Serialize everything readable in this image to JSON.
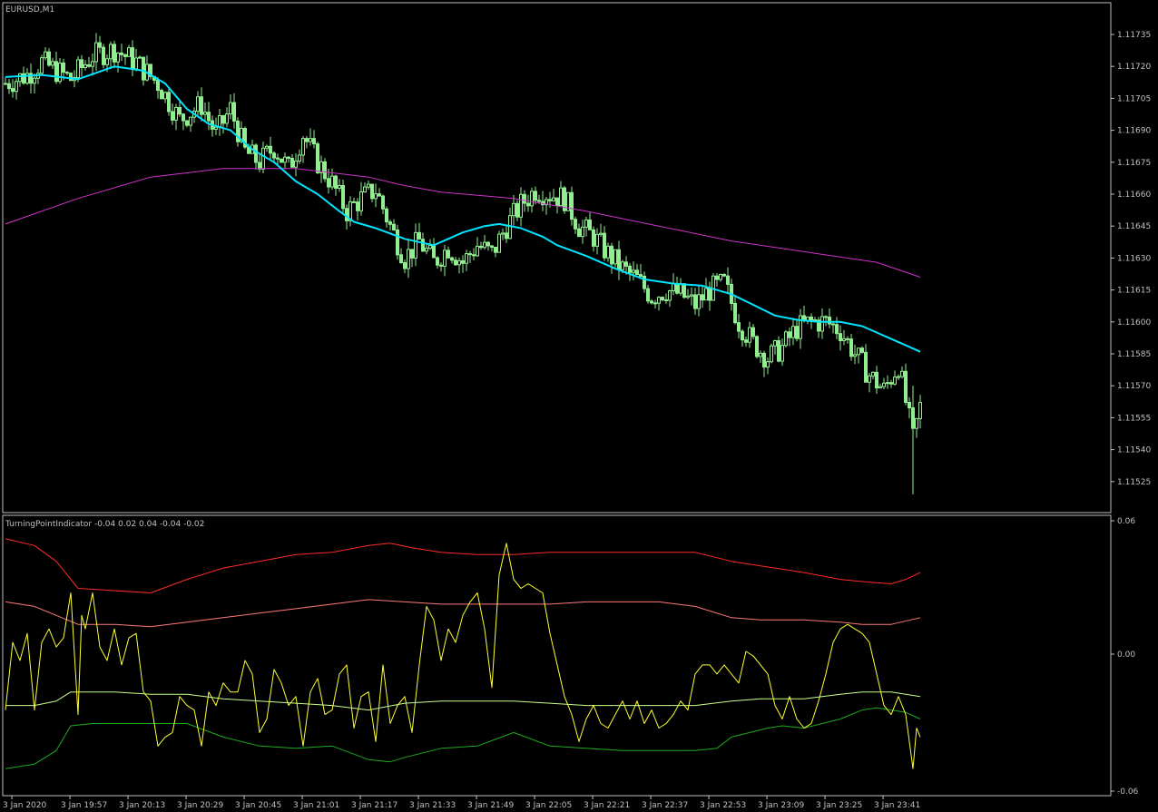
{
  "main_panel": {
    "title": "EURUSD,M1",
    "price_ticks": [
      "1.11735",
      "1.11720",
      "1.11705",
      "1.11690",
      "1.11675",
      "1.11660",
      "1.11645",
      "1.11630",
      "1.11615",
      "1.11600",
      "1.11585",
      "1.11570",
      "1.11555",
      "1.11540",
      "1.11525"
    ]
  },
  "indicator_panel": {
    "title": "TurningPointIndicator -0.04 0.02 0.04 -0.04 -0.02",
    "ticks": [
      "0.06",
      "0.00",
      "-0.06"
    ]
  },
  "time_ticks": [
    "3 Jan 2020",
    "3 Jan 19:57",
    "3 Jan 20:13",
    "3 Jan 20:29",
    "3 Jan 20:45",
    "3 Jan 21:01",
    "3 Jan 21:17",
    "3 Jan 21:33",
    "3 Jan 21:49",
    "3 Jan 22:05",
    "3 Jan 22:21",
    "3 Jan 22:37",
    "3 Jan 22:53",
    "3 Jan 23:09",
    "3 Jan 23:25",
    "3 Jan 23:41"
  ],
  "colors": {
    "background": "#000000",
    "frame": "#c0c0c0",
    "candle": "#90ee90",
    "fast_ma": "#00e5ff",
    "slow_ma": "#cc33cc",
    "upper_outer": "#ff2a2a",
    "upper_inner": "#ff7a7a",
    "oscillator": "#ffff33",
    "lower_inner": "#c8ff8a",
    "lower_outer": "#1faa1f",
    "text": "#c0c0c0"
  },
  "chart_data": {
    "type": "line",
    "main": {
      "ylim": [
        1.11515,
        1.11745
      ],
      "close_series": {
        "x_bar": [
          0,
          6,
          10,
          14,
          18,
          24,
          30,
          36,
          42,
          48,
          54,
          58,
          62,
          66,
          70,
          74,
          78,
          82,
          86,
          90,
          94,
          98,
          102,
          106,
          110,
          114,
          118,
          122,
          126,
          130,
          134,
          138,
          142,
          146,
          150,
          154,
          158,
          162,
          166,
          170,
          174,
          178,
          182,
          186,
          190,
          194,
          198,
          202,
          206,
          210,
          214,
          218,
          222,
          226,
          230,
          234,
          238,
          242,
          246,
          250,
          252
        ],
        "y": [
          1.11712,
          1.11716,
          1.11722,
          1.11718,
          1.11714,
          1.11725,
          1.11728,
          1.11722,
          1.11712,
          1.11695,
          1.11702,
          1.11688,
          1.117,
          1.1168,
          1.11675,
          1.11682,
          1.11672,
          1.11688,
          1.11675,
          1.11665,
          1.11652,
          1.11658,
          1.11662,
          1.11645,
          1.1163,
          1.11638,
          1.11628,
          1.11635,
          1.11628,
          1.11636,
          1.11632,
          1.11645,
          1.11655,
          1.11662,
          1.1166,
          1.11658,
          1.11645,
          1.1164,
          1.11632,
          1.11625,
          1.1162,
          1.11612,
          1.11615,
          1.11613,
          1.11608,
          1.11615,
          1.11618,
          1.116,
          1.1159,
          1.11583,
          1.11588,
          1.11597,
          1.116,
          1.116,
          1.11596,
          1.11585,
          1.11575,
          1.11568,
          1.1158,
          1.11545,
          1.1156
        ]
      },
      "fast_ma": {
        "x_bar": [
          0,
          10,
          20,
          30,
          38,
          44,
          50,
          56,
          62,
          68,
          74,
          80,
          86,
          92,
          96,
          102,
          110,
          118,
          126,
          132,
          136,
          142,
          148,
          152,
          160,
          168,
          176,
          184,
          192,
          200,
          206,
          212,
          218,
          224,
          230,
          236,
          240,
          244,
          248,
          252
        ],
        "y": [
          1.11715,
          1.11716,
          1.11714,
          1.1172,
          1.11718,
          1.11712,
          1.117,
          1.11693,
          1.1169,
          1.11681,
          1.11675,
          1.11666,
          1.1166,
          1.11652,
          1.11647,
          1.11644,
          1.11639,
          1.11636,
          1.11642,
          1.11645,
          1.11646,
          1.11644,
          1.1164,
          1.11636,
          1.11631,
          1.11625,
          1.1162,
          1.11618,
          1.11617,
          1.11613,
          1.11608,
          1.11603,
          1.11601,
          1.116,
          1.116,
          1.11598,
          1.11595,
          1.11592,
          1.11589,
          1.11586
        ]
      },
      "slow_ma": {
        "x_bar": [
          0,
          20,
          40,
          60,
          80,
          100,
          110,
          120,
          140,
          160,
          180,
          200,
          220,
          240,
          252
        ],
        "y": [
          1.11646,
          1.11658,
          1.11668,
          1.11672,
          1.11672,
          1.11668,
          1.11664,
          1.11661,
          1.11658,
          1.11652,
          1.11645,
          1.11638,
          1.11633,
          1.11628,
          1.11621
        ]
      }
    },
    "indicator": {
      "ylim": [
        -0.06,
        0.06
      ],
      "upper_outer": {
        "x_bar": [
          0,
          8,
          14,
          20,
          30,
          40,
          50,
          60,
          70,
          80,
          90,
          100,
          106,
          112,
          120,
          130,
          140,
          150,
          160,
          170,
          180,
          190,
          200,
          208,
          212,
          220,
          230,
          236,
          244,
          248,
          252
        ],
        "y": [
          0.052,
          0.049,
          0.042,
          0.03,
          0.029,
          0.028,
          0.034,
          0.039,
          0.042,
          0.045,
          0.046,
          0.049,
          0.05,
          0.048,
          0.046,
          0.045,
          0.045,
          0.046,
          0.046,
          0.046,
          0.046,
          0.046,
          0.042,
          0.04,
          0.039,
          0.037,
          0.034,
          0.033,
          0.032,
          0.034,
          0.037
        ]
      },
      "upper_inner": {
        "x_bar": [
          0,
          8,
          14,
          20,
          30,
          40,
          50,
          60,
          70,
          80,
          90,
          100,
          110,
          120,
          130,
          140,
          150,
          160,
          170,
          180,
          190,
          200,
          208,
          220,
          230,
          236,
          244,
          252
        ],
        "y": [
          0.024,
          0.022,
          0.018,
          0.014,
          0.014,
          0.013,
          0.015,
          0.017,
          0.019,
          0.021,
          0.023,
          0.025,
          0.024,
          0.023,
          0.023,
          0.023,
          0.023,
          0.024,
          0.024,
          0.024,
          0.022,
          0.017,
          0.016,
          0.016,
          0.015,
          0.014,
          0.014,
          0.017
        ]
      },
      "lower_inner": {
        "x_bar": [
          0,
          8,
          14,
          18,
          24,
          30,
          40,
          50,
          60,
          70,
          80,
          90,
          100,
          110,
          120,
          130,
          140,
          150,
          160,
          170,
          180,
          190,
          200,
          208,
          214,
          220,
          230,
          236,
          244,
          248,
          252
        ],
        "y": [
          -0.022,
          -0.022,
          -0.02,
          -0.016,
          -0.016,
          -0.016,
          -0.017,
          -0.017,
          -0.019,
          -0.02,
          -0.021,
          -0.022,
          -0.024,
          -0.021,
          -0.02,
          -0.02,
          -0.02,
          -0.021,
          -0.022,
          -0.022,
          -0.022,
          -0.022,
          -0.02,
          -0.019,
          -0.019,
          -0.019,
          -0.017,
          -0.016,
          -0.016,
          -0.017,
          -0.018
        ]
      },
      "lower_outer": {
        "x_bar": [
          0,
          8,
          14,
          18,
          24,
          30,
          40,
          50,
          60,
          70,
          80,
          90,
          100,
          106,
          110,
          120,
          130,
          140,
          150,
          160,
          170,
          180,
          190,
          196,
          200,
          210,
          214,
          220,
          230,
          236,
          240,
          244,
          248,
          252
        ],
        "y": [
          -0.05,
          -0.048,
          -0.042,
          -0.031,
          -0.03,
          -0.03,
          -0.03,
          -0.03,
          -0.036,
          -0.04,
          -0.041,
          -0.04,
          -0.046,
          -0.047,
          -0.045,
          -0.041,
          -0.04,
          -0.034,
          -0.04,
          -0.041,
          -0.042,
          -0.042,
          -0.042,
          -0.041,
          -0.036,
          -0.032,
          -0.031,
          -0.032,
          -0.028,
          -0.024,
          -0.023,
          -0.024,
          -0.025,
          -0.028
        ]
      },
      "oscillator": {
        "x_bar": [
          0,
          2,
          4,
          6,
          8,
          10,
          12,
          14,
          16,
          18,
          20,
          21,
          22,
          24,
          26,
          28,
          30,
          32,
          34,
          36,
          38,
          40,
          42,
          44,
          46,
          48,
          50,
          52,
          54,
          56,
          58,
          60,
          62,
          64,
          66,
          68,
          70,
          72,
          74,
          76,
          78,
          80,
          82,
          84,
          86,
          88,
          90,
          92,
          94,
          96,
          98,
          100,
          102,
          104,
          106,
          108,
          110,
          112,
          114,
          116,
          118,
          120,
          122,
          124,
          126,
          128,
          130,
          132,
          134,
          136,
          138,
          140,
          142,
          144,
          146,
          148,
          150,
          152,
          154,
          156,
          158,
          160,
          162,
          164,
          166,
          168,
          170,
          172,
          174,
          176,
          178,
          180,
          182,
          184,
          186,
          188,
          190,
          192,
          194,
          196,
          198,
          200,
          202,
          204,
          206,
          208,
          210,
          212,
          214,
          216,
          218,
          220,
          222,
          224,
          226,
          228,
          230,
          232,
          234,
          236,
          238,
          240,
          242,
          244,
          246,
          248,
          250,
          251,
          252
        ],
        "y": [
          -0.024,
          0.006,
          -0.002,
          0.01,
          -0.024,
          0.006,
          0.012,
          0.004,
          0.008,
          0.028,
          -0.026,
          0.018,
          0.012,
          0.028,
          0.004,
          -0.002,
          0.012,
          -0.004,
          0.008,
          0.01,
          -0.016,
          -0.02,
          -0.04,
          -0.036,
          -0.034,
          -0.018,
          -0.022,
          -0.024,
          -0.04,
          -0.016,
          -0.022,
          -0.012,
          -0.016,
          -0.016,
          -0.002,
          -0.008,
          -0.034,
          -0.028,
          -0.006,
          -0.012,
          -0.022,
          -0.018,
          -0.04,
          -0.016,
          -0.01,
          -0.026,
          -0.024,
          -0.008,
          -0.004,
          -0.032,
          -0.018,
          -0.016,
          -0.038,
          -0.004,
          -0.03,
          -0.022,
          -0.018,
          -0.034,
          -0.004,
          0.022,
          0.016,
          -0.002,
          0.012,
          0.006,
          0.018,
          0.024,
          0.028,
          0.012,
          -0.014,
          0.036,
          0.05,
          0.034,
          0.03,
          0.032,
          0.03,
          0.028,
          0.01,
          -0.004,
          -0.018,
          -0.026,
          -0.038,
          -0.028,
          -0.022,
          -0.03,
          -0.032,
          -0.026,
          -0.02,
          -0.028,
          -0.02,
          -0.03,
          -0.024,
          -0.032,
          -0.03,
          -0.026,
          -0.02,
          -0.024,
          -0.008,
          -0.004,
          -0.004,
          -0.008,
          -0.004,
          -0.008,
          -0.012,
          0.002,
          0.0,
          -0.004,
          -0.008,
          -0.022,
          -0.028,
          -0.018,
          -0.028,
          -0.032,
          -0.03,
          -0.02,
          -0.008,
          0.006,
          0.012,
          0.014,
          0.012,
          0.01,
          0.006,
          -0.008,
          -0.022,
          -0.026,
          -0.018,
          -0.026,
          -0.05,
          -0.032,
          -0.036
        ]
      }
    }
  }
}
